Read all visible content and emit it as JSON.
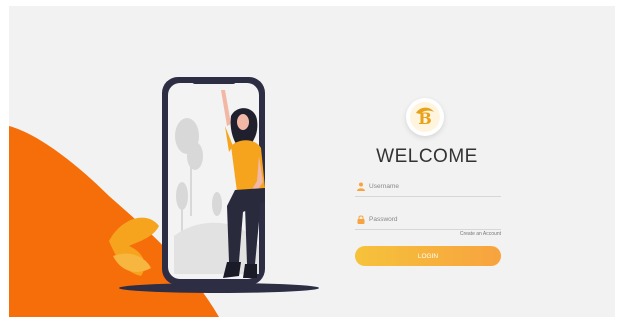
{
  "welcome": {
    "title": "WELCOME"
  },
  "form": {
    "username_placeholder": "Username",
    "password_placeholder": "Password",
    "create_account": "Create an Account",
    "login_label": "LOGIN"
  },
  "icons": {
    "username": "user-icon",
    "password": "lock-icon",
    "logo": "bitcoin-logo-icon"
  },
  "colors": {
    "accent_orange": "#f56e0a",
    "button_start": "#f6c23b",
    "button_end": "#f7a33f",
    "phone_frame": "#2d2d44",
    "leaf": "#f6a41d"
  }
}
